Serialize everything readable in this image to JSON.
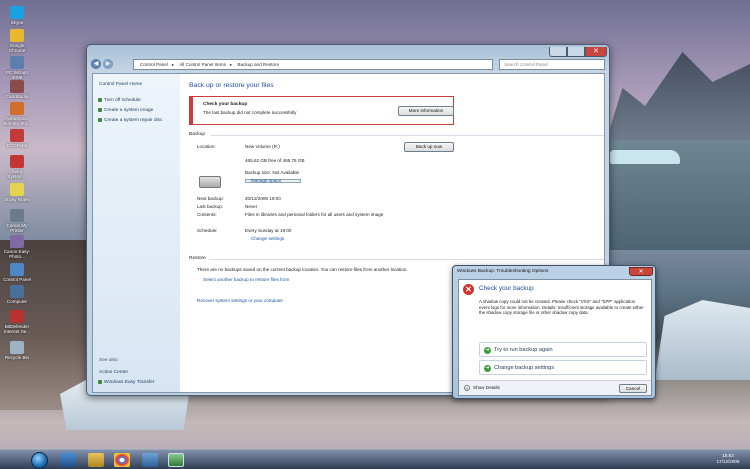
{
  "desktop_icons": [
    {
      "label": "Skype",
      "color": "#1aa1e1"
    },
    {
      "label": "Google Chrome",
      "color": "#e9b830"
    },
    {
      "label": "PC Wizard 2009",
      "color": "#5d7fb0"
    },
    {
      "label": "CamStudio",
      "color": "#8a4b4b"
    },
    {
      "label": "Ashampoo Burning Stu...",
      "color": "#d06f2a"
    },
    {
      "label": "DVDFab6",
      "color": "#c23a3a"
    },
    {
      "label": "Avira System...",
      "color": "#c43535"
    },
    {
      "label": "Sticky Notes",
      "color": "#e4d34c"
    },
    {
      "label": "Canon My Printer",
      "color": "#6c7b8a"
    },
    {
      "label": "Canon Easy-Photo...",
      "color": "#7f6aa3"
    },
    {
      "label": "Control Panel",
      "color": "#4f86c6"
    },
    {
      "label": "Computer",
      "color": "#4a6f9a"
    },
    {
      "label": "BitDefender Internet Se...",
      "color": "#b73131"
    },
    {
      "label": "Recycle Bin",
      "color": "#9fb2c4"
    }
  ],
  "window": {
    "breadcrumb": [
      "Control Panel",
      "All Control Panel Items",
      "Backup and Restore"
    ],
    "search_placeholder": "Search Control Panel",
    "left_pane": {
      "home": "Control Panel Home",
      "tasks": [
        "Turn off schedule",
        "Create a system image",
        "Create a system repair disc"
      ],
      "see_also_title": "See also",
      "see_also": [
        "Action Center",
        "Windows Easy Transfer"
      ]
    },
    "title": "Back up or restore your files",
    "alert": {
      "title": "Check your backup",
      "message": "The last backup did not complete successfully",
      "button": "More information"
    },
    "backup": {
      "section": "Backup",
      "location_label": "Location:",
      "location_value": "New Volume (R:)",
      "free_space": "465.62 GB free of 465.76 GB",
      "backup_size": "Backup size: Not Available",
      "manage_space": "Manage space",
      "backup_now": "Back up now",
      "next_backup_label": "Next backup:",
      "next_backup_value": "20/12/2009 19:00",
      "last_backup_label": "Last backup:",
      "last_backup_value": "Never",
      "contents_label": "Contents:",
      "contents_value": "Files in libraries and personal folders for all users and system image",
      "schedule_label": "Schedule:",
      "schedule_value": "Every Sunday at 19:00",
      "change_settings": "Change settings"
    },
    "restore": {
      "section": "Restore",
      "message": "There are no backups saved on the current backup location. You can restore files from another location.",
      "select_another": "Select another backup to restore files from",
      "recover_settings": "Recover system settings or your computer"
    }
  },
  "dialog": {
    "title": "Windows Backup: Troubleshooting Options",
    "heading": "Check your backup",
    "message": "A shadow copy could not be created. Please check \"VSS\" and \"SPP\" application event logs for more information. Details: Insufficient storage available to create either the shadow copy storage file or other shadow copy data.",
    "option1": "Try to run backup again",
    "option2": "Change backup settings",
    "show_details": "Show Details",
    "cancel": "Cancel"
  },
  "taskbar": {
    "time": "15:53",
    "date": "17/12/2009"
  }
}
